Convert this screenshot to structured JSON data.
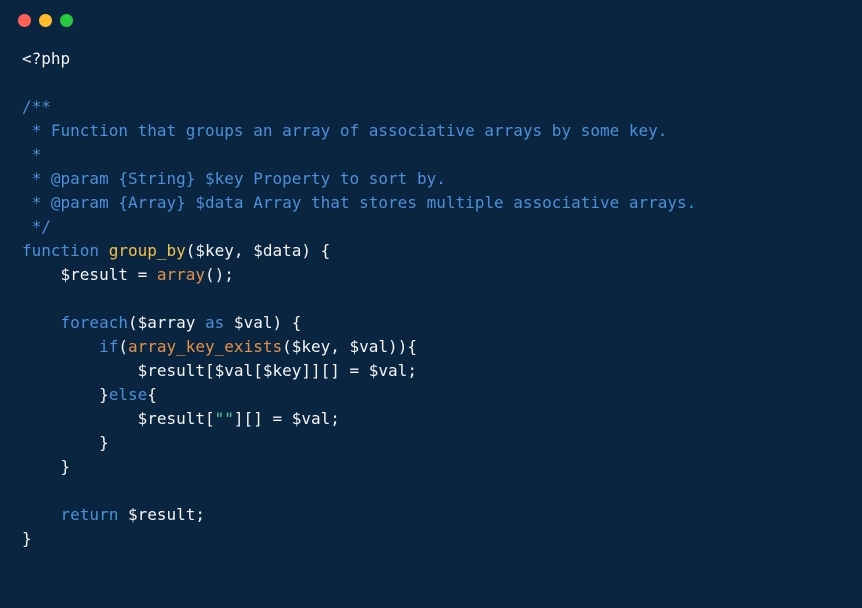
{
  "code": {
    "lines": [
      [
        {
          "t": "<?php",
          "c": "c-white"
        }
      ],
      [],
      [
        {
          "t": "/**",
          "c": "c-comment"
        }
      ],
      [
        {
          "t": " * Function that groups an array of associative arrays by some key.",
          "c": "c-comment"
        }
      ],
      [
        {
          "t": " *",
          "c": "c-comment"
        }
      ],
      [
        {
          "t": " * @param {String} $key Property to sort by.",
          "c": "c-comment"
        }
      ],
      [
        {
          "t": " * @param {Array} $data Array that stores multiple associative arrays.",
          "c": "c-comment"
        }
      ],
      [
        {
          "t": " */",
          "c": "c-comment"
        }
      ],
      [
        {
          "t": "function",
          "c": "c-keyword"
        },
        {
          "t": " ",
          "c": "c-white"
        },
        {
          "t": "group_by",
          "c": "c-func"
        },
        {
          "t": "($key, $data) {",
          "c": "c-white"
        }
      ],
      [
        {
          "t": "    $result = ",
          "c": "c-white"
        },
        {
          "t": "array",
          "c": "c-builtin"
        },
        {
          "t": "();",
          "c": "c-white"
        }
      ],
      [],
      [
        {
          "t": "    ",
          "c": "c-white"
        },
        {
          "t": "foreach",
          "c": "c-keyword"
        },
        {
          "t": "($array ",
          "c": "c-white"
        },
        {
          "t": "as",
          "c": "c-keyword"
        },
        {
          "t": " $val) {",
          "c": "c-white"
        }
      ],
      [
        {
          "t": "        ",
          "c": "c-white"
        },
        {
          "t": "if",
          "c": "c-keyword"
        },
        {
          "t": "(",
          "c": "c-white"
        },
        {
          "t": "array_key_exists",
          "c": "c-builtin"
        },
        {
          "t": "($key, $val)){",
          "c": "c-white"
        }
      ],
      [
        {
          "t": "            $result[$val[$key]][] = $val;",
          "c": "c-white"
        }
      ],
      [
        {
          "t": "        }",
          "c": "c-white"
        },
        {
          "t": "else",
          "c": "c-keyword"
        },
        {
          "t": "{",
          "c": "c-white"
        }
      ],
      [
        {
          "t": "            $result[",
          "c": "c-white"
        },
        {
          "t": "\"\"",
          "c": "c-string"
        },
        {
          "t": "][] = $val;",
          "c": "c-white"
        }
      ],
      [
        {
          "t": "        }",
          "c": "c-white"
        }
      ],
      [
        {
          "t": "    }",
          "c": "c-white"
        }
      ],
      [],
      [
        {
          "t": "    ",
          "c": "c-white"
        },
        {
          "t": "return",
          "c": "c-keyword"
        },
        {
          "t": " $result;",
          "c": "c-white"
        }
      ],
      [
        {
          "t": "}",
          "c": "c-white"
        }
      ]
    ]
  }
}
